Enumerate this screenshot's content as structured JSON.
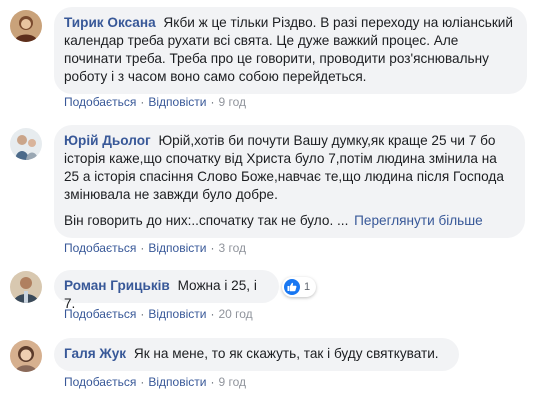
{
  "comments": [
    {
      "author": "Тирик Оксана",
      "text": "Якби ж це тільки Різдво. В разі переходу на юліанський календар треба рухати всі свята. Це дуже важкий процес. Але починати треба. Треба про це говорити, проводити роз'яснювальну роботу і з часом воно само собою перейдеться.",
      "like_label": "Подобається",
      "reply_label": "Відповісти",
      "time": "9 год",
      "avatar_colors": [
        "#c9a27a",
        "#7a4a2e"
      ]
    },
    {
      "author": "Юрій Дьолог",
      "text": "Юрій,хотів би почути Вашу думку,як краще 25 чи 7 бо історія каже,що спочатку від Христа було 7,потім людина змінила на 25 а історія спасіння Слово Боже,навчає те,що людина після Господа змінювала не завжди було добре.",
      "text2": "Він говорить до них:..спочатку так не було.",
      "ellipsis": "...",
      "see_more": "Переглянути більше",
      "like_label": "Подобається",
      "reply_label": "Відповісти",
      "time": "3 год",
      "avatar_colors": [
        "#e7ecef",
        "#4b6a8a"
      ]
    },
    {
      "author": "Роман Грицьків",
      "text": "Можна і 25, і 7.",
      "reaction_count": "1",
      "like_label": "Подобається",
      "reply_label": "Відповісти",
      "time": "20 год",
      "avatar_colors": [
        "#3a4a5a",
        "#d8c8b0"
      ]
    },
    {
      "author": "Галя Жук",
      "text": "Як на мене, то як скажуть, так і буду святкувати.",
      "like_label": "Подобається",
      "reply_label": "Відповісти",
      "time": "9 год",
      "avatar_colors": [
        "#d6b08f",
        "#5a3a2a"
      ]
    }
  ],
  "separator": "·",
  "colors": {
    "link": "#385898",
    "bubble": "#f2f3f5",
    "meta": "#90949c",
    "like": "#1877f2"
  }
}
